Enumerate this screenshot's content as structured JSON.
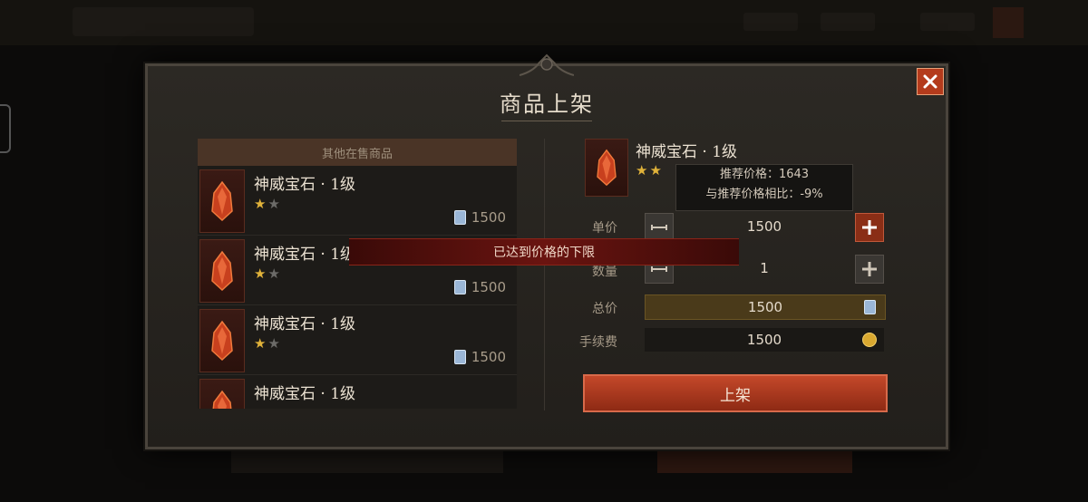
{
  "dialog": {
    "title": "商品上架",
    "left_panel": {
      "header": "其他在售商品",
      "items": [
        {
          "name": "神威宝石 · 1级",
          "stars_filled": 1,
          "stars_total": 2,
          "price": "1500"
        },
        {
          "name": "神威宝石 · 1级",
          "stars_filled": 1,
          "stars_total": 2,
          "price": "1500"
        },
        {
          "name": "神威宝石 · 1级",
          "stars_filled": 1,
          "stars_total": 2,
          "price": "1500"
        },
        {
          "name": "神威宝石 · 1级",
          "stars_filled": 1,
          "stars_total": 2,
          "price": ""
        }
      ]
    },
    "selected_item": {
      "name": "神威宝石 · 1级",
      "stars_filled": 2,
      "tooltip": {
        "recommended": "推荐价格：1643",
        "compare": "与推荐价格相比：-9%"
      }
    },
    "fields": {
      "unit_price_label": "单价",
      "unit_price": "1500",
      "quantity_label": "数量",
      "quantity": "1",
      "total_label": "总价",
      "total": "1500",
      "fee_label": "手续费",
      "fee": "1500"
    },
    "list_button": "上架",
    "toast": "已达到价格的下限"
  },
  "colors": {
    "accent_red": "#b43b1c",
    "star_gold": "#e0b23a",
    "currency_blue": "#9ab6d6",
    "coin_gold": "#d9a830"
  },
  "icons": [
    "close-icon",
    "gem-icon",
    "platinum-currency-icon",
    "gold-coin-icon",
    "plus-icon",
    "minus-icon",
    "star-icon"
  ]
}
